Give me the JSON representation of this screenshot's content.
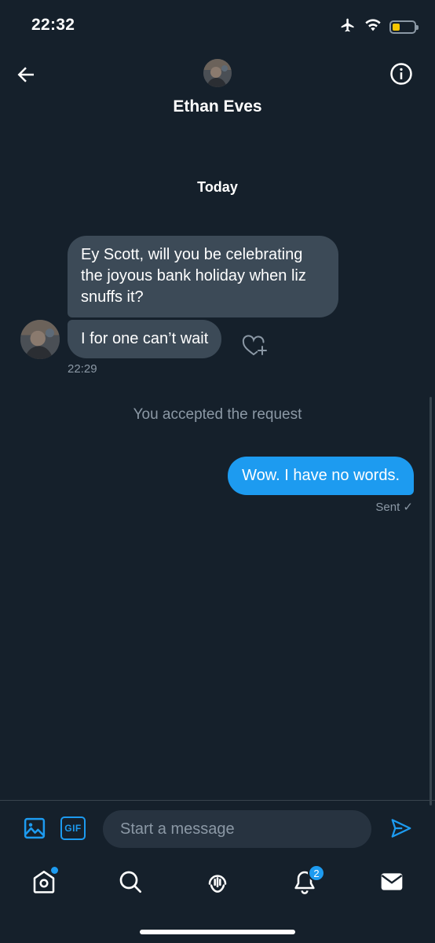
{
  "status_bar": {
    "time": "22:32",
    "icons": [
      "airplane-icon",
      "wifi-icon",
      "battery-icon"
    ],
    "battery_color": "#f7c600"
  },
  "header": {
    "contact_name": "Ethan Eves"
  },
  "conversation": {
    "day_label": "Today",
    "incoming": [
      {
        "text": "Ey Scott, will you be celebrating the joyous bank holiday when liz snuffs it?"
      },
      {
        "text": "I for one can’t wait"
      }
    ],
    "incoming_time": "22:29",
    "system_message": "You accepted the request",
    "outgoing": [
      {
        "text": "Wow. I have no words.",
        "status": "Sent ✓"
      }
    ]
  },
  "composer": {
    "gif_label": "GIF",
    "placeholder": "Start a message"
  },
  "tab_bar": {
    "items": [
      "home-icon",
      "search-icon",
      "spaces-icon",
      "notifications-icon",
      "messages-icon"
    ],
    "notification_count": "2"
  },
  "colors": {
    "background": "#15202b",
    "accent": "#1d9bf0",
    "incoming_bubble": "#3c4a57",
    "muted_text": "#8b98a5"
  }
}
